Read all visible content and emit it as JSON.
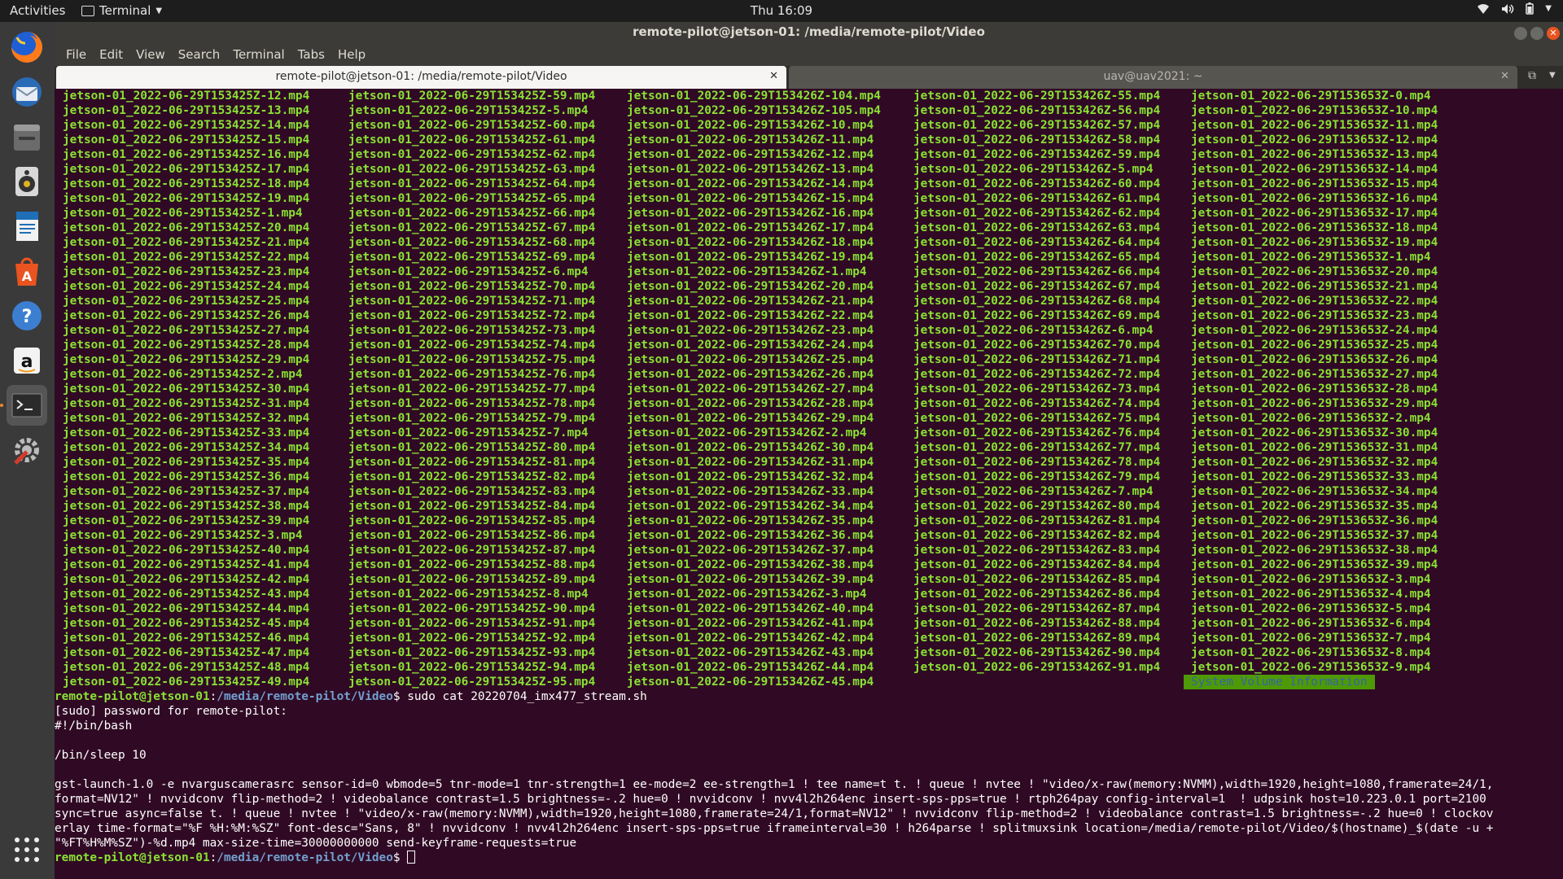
{
  "topbar": {
    "activities": "Activities",
    "app_name": "Terminal",
    "clock": "Thu 16:09"
  },
  "dock": {
    "items": [
      "firefox-icon",
      "thunderbird-icon",
      "files-icon",
      "rhythmbox-icon",
      "writer-icon",
      "software-center-icon",
      "help-icon",
      "amazon-icon",
      "terminal-icon",
      "settings-icon",
      "show-apps-icon"
    ]
  },
  "window": {
    "title": "remote-pilot@jetson-01: /media/remote-pilot/Video",
    "menu": [
      "File",
      "Edit",
      "View",
      "Search",
      "Terminal",
      "Tabs",
      "Help"
    ],
    "tabs": [
      {
        "label": "remote-pilot@jetson-01: /media/remote-pilot/Video"
      },
      {
        "label": "uav@uav2021: ~"
      }
    ]
  },
  "listing": {
    "columns": [
      [
        "jetson-01_2022-06-29T153425Z-12.mp4",
        "jetson-01_2022-06-29T153425Z-13.mp4",
        "jetson-01_2022-06-29T153425Z-14.mp4",
        "jetson-01_2022-06-29T153425Z-15.mp4",
        "jetson-01_2022-06-29T153425Z-16.mp4",
        "jetson-01_2022-06-29T153425Z-17.mp4",
        "jetson-01_2022-06-29T153425Z-18.mp4",
        "jetson-01_2022-06-29T153425Z-19.mp4",
        "jetson-01_2022-06-29T153425Z-1.mp4",
        "jetson-01_2022-06-29T153425Z-20.mp4",
        "jetson-01_2022-06-29T153425Z-21.mp4",
        "jetson-01_2022-06-29T153425Z-22.mp4",
        "jetson-01_2022-06-29T153425Z-23.mp4",
        "jetson-01_2022-06-29T153425Z-24.mp4",
        "jetson-01_2022-06-29T153425Z-25.mp4",
        "jetson-01_2022-06-29T153425Z-26.mp4",
        "jetson-01_2022-06-29T153425Z-27.mp4",
        "jetson-01_2022-06-29T153425Z-28.mp4",
        "jetson-01_2022-06-29T153425Z-29.mp4",
        "jetson-01_2022-06-29T153425Z-2.mp4",
        "jetson-01_2022-06-29T153425Z-30.mp4",
        "jetson-01_2022-06-29T153425Z-31.mp4",
        "jetson-01_2022-06-29T153425Z-32.mp4",
        "jetson-01_2022-06-29T153425Z-33.mp4",
        "jetson-01_2022-06-29T153425Z-34.mp4",
        "jetson-01_2022-06-29T153425Z-35.mp4",
        "jetson-01_2022-06-29T153425Z-36.mp4",
        "jetson-01_2022-06-29T153425Z-37.mp4",
        "jetson-01_2022-06-29T153425Z-38.mp4",
        "jetson-01_2022-06-29T153425Z-39.mp4",
        "jetson-01_2022-06-29T153425Z-3.mp4",
        "jetson-01_2022-06-29T153425Z-40.mp4",
        "jetson-01_2022-06-29T153425Z-41.mp4",
        "jetson-01_2022-06-29T153425Z-42.mp4",
        "jetson-01_2022-06-29T153425Z-43.mp4",
        "jetson-01_2022-06-29T153425Z-44.mp4",
        "jetson-01_2022-06-29T153425Z-45.mp4",
        "jetson-01_2022-06-29T153425Z-46.mp4",
        "jetson-01_2022-06-29T153425Z-47.mp4",
        "jetson-01_2022-06-29T153425Z-48.mp4",
        "jetson-01_2022-06-29T153425Z-49.mp4"
      ],
      [
        "jetson-01_2022-06-29T153425Z-59.mp4",
        "jetson-01_2022-06-29T153425Z-5.mp4",
        "jetson-01_2022-06-29T153425Z-60.mp4",
        "jetson-01_2022-06-29T153425Z-61.mp4",
        "jetson-01_2022-06-29T153425Z-62.mp4",
        "jetson-01_2022-06-29T153425Z-63.mp4",
        "jetson-01_2022-06-29T153425Z-64.mp4",
        "jetson-01_2022-06-29T153425Z-65.mp4",
        "jetson-01_2022-06-29T153425Z-66.mp4",
        "jetson-01_2022-06-29T153425Z-67.mp4",
        "jetson-01_2022-06-29T153425Z-68.mp4",
        "jetson-01_2022-06-29T153425Z-69.mp4",
        "jetson-01_2022-06-29T153425Z-6.mp4",
        "jetson-01_2022-06-29T153425Z-70.mp4",
        "jetson-01_2022-06-29T153425Z-71.mp4",
        "jetson-01_2022-06-29T153425Z-72.mp4",
        "jetson-01_2022-06-29T153425Z-73.mp4",
        "jetson-01_2022-06-29T153425Z-74.mp4",
        "jetson-01_2022-06-29T153425Z-75.mp4",
        "jetson-01_2022-06-29T153425Z-76.mp4",
        "jetson-01_2022-06-29T153425Z-77.mp4",
        "jetson-01_2022-06-29T153425Z-78.mp4",
        "jetson-01_2022-06-29T153425Z-79.mp4",
        "jetson-01_2022-06-29T153425Z-7.mp4",
        "jetson-01_2022-06-29T153425Z-80.mp4",
        "jetson-01_2022-06-29T153425Z-81.mp4",
        "jetson-01_2022-06-29T153425Z-82.mp4",
        "jetson-01_2022-06-29T153425Z-83.mp4",
        "jetson-01_2022-06-29T153425Z-84.mp4",
        "jetson-01_2022-06-29T153425Z-85.mp4",
        "jetson-01_2022-06-29T153425Z-86.mp4",
        "jetson-01_2022-06-29T153425Z-87.mp4",
        "jetson-01_2022-06-29T153425Z-88.mp4",
        "jetson-01_2022-06-29T153425Z-89.mp4",
        "jetson-01_2022-06-29T153425Z-8.mp4",
        "jetson-01_2022-06-29T153425Z-90.mp4",
        "jetson-01_2022-06-29T153425Z-91.mp4",
        "jetson-01_2022-06-29T153425Z-92.mp4",
        "jetson-01_2022-06-29T153425Z-93.mp4",
        "jetson-01_2022-06-29T153425Z-94.mp4",
        "jetson-01_2022-06-29T153425Z-95.mp4"
      ],
      [
        "jetson-01_2022-06-29T153426Z-104.mp4",
        "jetson-01_2022-06-29T153426Z-105.mp4",
        "jetson-01_2022-06-29T153426Z-10.mp4",
        "jetson-01_2022-06-29T153426Z-11.mp4",
        "jetson-01_2022-06-29T153426Z-12.mp4",
        "jetson-01_2022-06-29T153426Z-13.mp4",
        "jetson-01_2022-06-29T153426Z-14.mp4",
        "jetson-01_2022-06-29T153426Z-15.mp4",
        "jetson-01_2022-06-29T153426Z-16.mp4",
        "jetson-01_2022-06-29T153426Z-17.mp4",
        "jetson-01_2022-06-29T153426Z-18.mp4",
        "jetson-01_2022-06-29T153426Z-19.mp4",
        "jetson-01_2022-06-29T153426Z-1.mp4",
        "jetson-01_2022-06-29T153426Z-20.mp4",
        "jetson-01_2022-06-29T153426Z-21.mp4",
        "jetson-01_2022-06-29T153426Z-22.mp4",
        "jetson-01_2022-06-29T153426Z-23.mp4",
        "jetson-01_2022-06-29T153426Z-24.mp4",
        "jetson-01_2022-06-29T153426Z-25.mp4",
        "jetson-01_2022-06-29T153426Z-26.mp4",
        "jetson-01_2022-06-29T153426Z-27.mp4",
        "jetson-01_2022-06-29T153426Z-28.mp4",
        "jetson-01_2022-06-29T153426Z-29.mp4",
        "jetson-01_2022-06-29T153426Z-2.mp4",
        "jetson-01_2022-06-29T153426Z-30.mp4",
        "jetson-01_2022-06-29T153426Z-31.mp4",
        "jetson-01_2022-06-29T153426Z-32.mp4",
        "jetson-01_2022-06-29T153426Z-33.mp4",
        "jetson-01_2022-06-29T153426Z-34.mp4",
        "jetson-01_2022-06-29T153426Z-35.mp4",
        "jetson-01_2022-06-29T153426Z-36.mp4",
        "jetson-01_2022-06-29T153426Z-37.mp4",
        "jetson-01_2022-06-29T153426Z-38.mp4",
        "jetson-01_2022-06-29T153426Z-39.mp4",
        "jetson-01_2022-06-29T153426Z-3.mp4",
        "jetson-01_2022-06-29T153426Z-40.mp4",
        "jetson-01_2022-06-29T153426Z-41.mp4",
        "jetson-01_2022-06-29T153426Z-42.mp4",
        "jetson-01_2022-06-29T153426Z-43.mp4",
        "jetson-01_2022-06-29T153426Z-44.mp4",
        "jetson-01_2022-06-29T153426Z-45.mp4"
      ],
      [
        "jetson-01_2022-06-29T153426Z-55.mp4",
        "jetson-01_2022-06-29T153426Z-56.mp4",
        "jetson-01_2022-06-29T153426Z-57.mp4",
        "jetson-01_2022-06-29T153426Z-58.mp4",
        "jetson-01_2022-06-29T153426Z-59.mp4",
        "jetson-01_2022-06-29T153426Z-5.mp4",
        "jetson-01_2022-06-29T153426Z-60.mp4",
        "jetson-01_2022-06-29T153426Z-61.mp4",
        "jetson-01_2022-06-29T153426Z-62.mp4",
        "jetson-01_2022-06-29T153426Z-63.mp4",
        "jetson-01_2022-06-29T153426Z-64.mp4",
        "jetson-01_2022-06-29T153426Z-65.mp4",
        "jetson-01_2022-06-29T153426Z-66.mp4",
        "jetson-01_2022-06-29T153426Z-67.mp4",
        "jetson-01_2022-06-29T153426Z-68.mp4",
        "jetson-01_2022-06-29T153426Z-69.mp4",
        "jetson-01_2022-06-29T153426Z-6.mp4",
        "jetson-01_2022-06-29T153426Z-70.mp4",
        "jetson-01_2022-06-29T153426Z-71.mp4",
        "jetson-01_2022-06-29T153426Z-72.mp4",
        "jetson-01_2022-06-29T153426Z-73.mp4",
        "jetson-01_2022-06-29T153426Z-74.mp4",
        "jetson-01_2022-06-29T153426Z-75.mp4",
        "jetson-01_2022-06-29T153426Z-76.mp4",
        "jetson-01_2022-06-29T153426Z-77.mp4",
        "jetson-01_2022-06-29T153426Z-78.mp4",
        "jetson-01_2022-06-29T153426Z-79.mp4",
        "jetson-01_2022-06-29T153426Z-7.mp4",
        "jetson-01_2022-06-29T153426Z-80.mp4",
        "jetson-01_2022-06-29T153426Z-81.mp4",
        "jetson-01_2022-06-29T153426Z-82.mp4",
        "jetson-01_2022-06-29T153426Z-83.mp4",
        "jetson-01_2022-06-29T153426Z-84.mp4",
        "jetson-01_2022-06-29T153426Z-85.mp4",
        "jetson-01_2022-06-29T153426Z-86.mp4",
        "jetson-01_2022-06-29T153426Z-87.mp4",
        "jetson-01_2022-06-29T153426Z-88.mp4",
        "jetson-01_2022-06-29T153426Z-89.mp4",
        "jetson-01_2022-06-29T153426Z-90.mp4",
        "jetson-01_2022-06-29T153426Z-91.mp4"
      ],
      [
        "jetson-01_2022-06-29T153653Z-0.mp4",
        "jetson-01_2022-06-29T153653Z-10.mp4",
        "jetson-01_2022-06-29T153653Z-11.mp4",
        "jetson-01_2022-06-29T153653Z-12.mp4",
        "jetson-01_2022-06-29T153653Z-13.mp4",
        "jetson-01_2022-06-29T153653Z-14.mp4",
        "jetson-01_2022-06-29T153653Z-15.mp4",
        "jetson-01_2022-06-29T153653Z-16.mp4",
        "jetson-01_2022-06-29T153653Z-17.mp4",
        "jetson-01_2022-06-29T153653Z-18.mp4",
        "jetson-01_2022-06-29T153653Z-19.mp4",
        "jetson-01_2022-06-29T153653Z-1.mp4",
        "jetson-01_2022-06-29T153653Z-20.mp4",
        "jetson-01_2022-06-29T153653Z-21.mp4",
        "jetson-01_2022-06-29T153653Z-22.mp4",
        "jetson-01_2022-06-29T153653Z-23.mp4",
        "jetson-01_2022-06-29T153653Z-24.mp4",
        "jetson-01_2022-06-29T153653Z-25.mp4",
        "jetson-01_2022-06-29T153653Z-26.mp4",
        "jetson-01_2022-06-29T153653Z-27.mp4",
        "jetson-01_2022-06-29T153653Z-28.mp4",
        "jetson-01_2022-06-29T153653Z-29.mp4",
        "jetson-01_2022-06-29T153653Z-2.mp4",
        "jetson-01_2022-06-29T153653Z-30.mp4",
        "jetson-01_2022-06-29T153653Z-31.mp4",
        "jetson-01_2022-06-29T153653Z-32.mp4",
        "jetson-01_2022-06-29T153653Z-33.mp4",
        "jetson-01_2022-06-29T153653Z-34.mp4",
        "jetson-01_2022-06-29T153653Z-35.mp4",
        "jetson-01_2022-06-29T153653Z-36.mp4",
        "jetson-01_2022-06-29T153653Z-37.mp4",
        "jetson-01_2022-06-29T153653Z-38.mp4",
        "jetson-01_2022-06-29T153653Z-39.mp4",
        "jetson-01_2022-06-29T153653Z-3.mp4",
        "jetson-01_2022-06-29T153653Z-4.mp4",
        "jetson-01_2022-06-29T153653Z-5.mp4",
        "jetson-01_2022-06-29T153653Z-6.mp4",
        "jetson-01_2022-06-29T153653Z-7.mp4",
        "jetson-01_2022-06-29T153653Z-8.mp4",
        "jetson-01_2022-06-29T153653Z-9.mp4"
      ]
    ],
    "special_entry": "System Volume Information"
  },
  "session": {
    "prompt_user": "remote-pilot@jetson-01",
    "prompt_sep": ":",
    "prompt_path": "/media/remote-pilot/Video",
    "prompt_end": "$ ",
    "command": "sudo cat 20220704_imx477_stream.sh",
    "output": [
      "[sudo] password for remote-pilot:",
      "#!/bin/bash",
      "",
      "/bin/sleep 10",
      "",
      "gst-launch-1.0 -e nvarguscamerasrc sensor-id=0 wbmode=5 tnr-mode=1 tnr-strength=1 ee-mode=2 ee-strength=1 ! tee name=t t. ! queue ! nvtee ! \"video/x-raw(memory:NVMM),width=1920,height=1080,framerate=24/1,",
      "format=NV12\" ! nvvidconv flip-method=2 ! videobalance contrast=1.5 brightness=-.2 hue=0 ! nvvidconv ! nvv4l2h264enc insert-sps-pps=true ! rtph264pay config-interval=1  ! udpsink host=10.223.0.1 port=2100",
      "sync=true async=false t. ! queue ! nvtee ! \"video/x-raw(memory:NVMM),width=1920,height=1080,framerate=24/1,format=NV12\" ! nvvidconv flip-method=2 ! videobalance contrast=1.5 brightness=-.2 hue=0 ! clockov",
      "erlay time-format=\"%F %H:%M:%SZ\" font-desc=\"Sans, 8\" ! nvvidconv ! nvv4l2h264enc insert-sps-pps=true iframeinterval=30 ! h264parse ! splitmuxsink location=/media/remote-pilot/Video/$(hostname)_$(date -u +",
      "\"%FT%H%M%SZ\")-%d.mp4 max-size-time=30000000000 send-keyframe-requests=true"
    ]
  },
  "colors": {
    "terminal_bg": "#300A24",
    "file_green": "#8ae234",
    "path_blue": "#729fcf",
    "launcher_bg": "#3a3a3a",
    "topbar_bg": "#1d1d1d",
    "close_orange": "#e95420"
  }
}
